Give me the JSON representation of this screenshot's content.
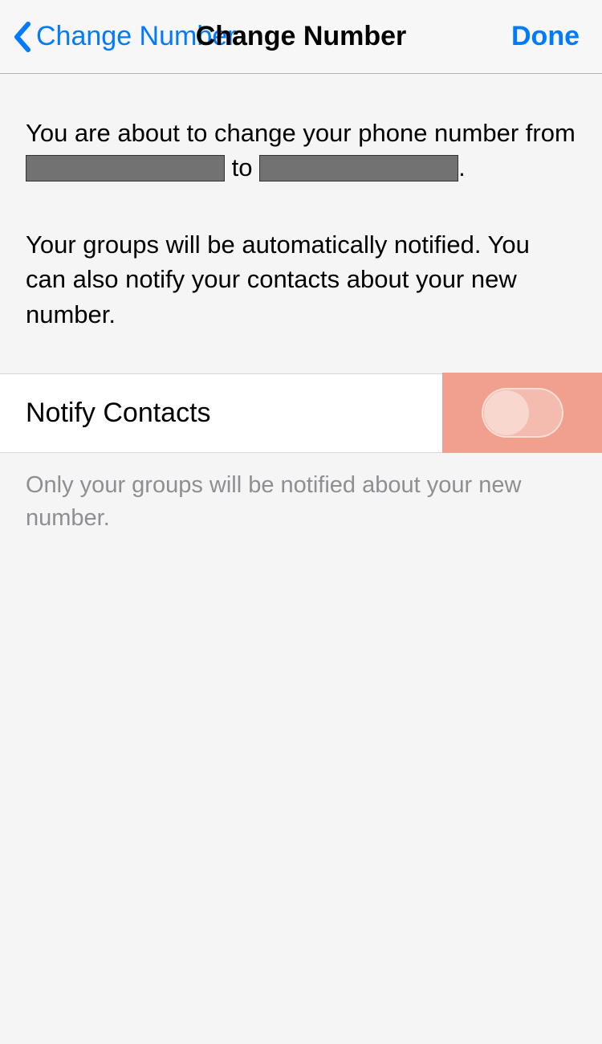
{
  "nav": {
    "back_label": "Change Number",
    "title": "Change Number",
    "done_label": "Done"
  },
  "description": {
    "line1_prefix": "You are about to change your phone number from ",
    "line1_mid": " to ",
    "line1_suffix": ".",
    "line2": "Your groups will be automatically notified. You can also notify your contacts about your new number."
  },
  "setting": {
    "notify_label": "Notify Contacts",
    "notify_state": "off"
  },
  "footer": {
    "text": "Only your groups will be notified about your new number."
  },
  "colors": {
    "ios_blue": "#007aff",
    "highlight_salmon": "#f0a08d"
  }
}
